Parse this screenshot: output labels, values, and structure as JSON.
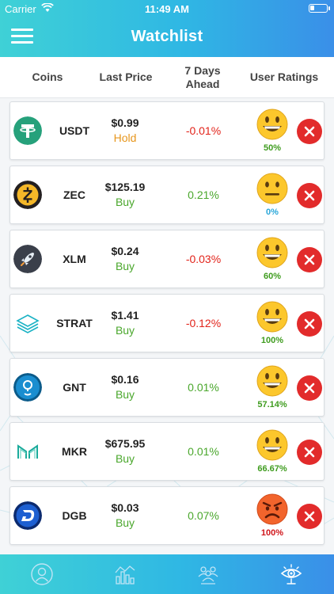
{
  "status": {
    "carrier": "Carrier",
    "time": "11:49 AM"
  },
  "header": {
    "title": "Watchlist"
  },
  "columns": {
    "coins": "Coins",
    "last_price": "Last Price",
    "days_line1": "7 Days",
    "days_line2": "Ahead",
    "ratings": "User Ratings"
  },
  "colors": {
    "accent_start": "#3fd1d6",
    "accent_end": "#3a8fe8",
    "negative": "#e2231a",
    "positive": "#4aa72c",
    "hold": "#e7961c",
    "remove": "#e22b2b"
  },
  "coins": [
    {
      "symbol": "USDT",
      "price": "$0.99",
      "signal": "Hold",
      "change": "-0.01%",
      "rating": "50%",
      "icon": "tether-icon",
      "emoji": "grinning-emoji"
    },
    {
      "symbol": "ZEC",
      "price": "$125.19",
      "signal": "Buy",
      "change": "0.21%",
      "rating": "0%",
      "icon": "zcash-icon",
      "emoji": "neutral-emoji"
    },
    {
      "symbol": "XLM",
      "price": "$0.24",
      "signal": "Buy",
      "change": "-0.03%",
      "rating": "60%",
      "icon": "stellar-icon",
      "emoji": "grinning-emoji"
    },
    {
      "symbol": "STRAT",
      "price": "$1.41",
      "signal": "Buy",
      "change": "-0.12%",
      "rating": "100%",
      "icon": "stratis-icon",
      "emoji": "grinning-emoji"
    },
    {
      "symbol": "GNT",
      "price": "$0.16",
      "signal": "Buy",
      "change": "0.01%",
      "rating": "57.14%",
      "icon": "golem-icon",
      "emoji": "grinning-emoji"
    },
    {
      "symbol": "MKR",
      "price": "$675.95",
      "signal": "Buy",
      "change": "0.01%",
      "rating": "66.67%",
      "icon": "maker-icon",
      "emoji": "grinning-emoji"
    },
    {
      "symbol": "DGB",
      "price": "$0.03",
      "signal": "Buy",
      "change": "0.07%",
      "rating": "100%",
      "icon": "digibyte-icon",
      "emoji": "angry-emoji"
    }
  ],
  "tabs": [
    {
      "icon": "profile-icon"
    },
    {
      "icon": "chart-icon"
    },
    {
      "icon": "community-icon"
    },
    {
      "icon": "watchlist-eye-icon",
      "active": true
    }
  ]
}
